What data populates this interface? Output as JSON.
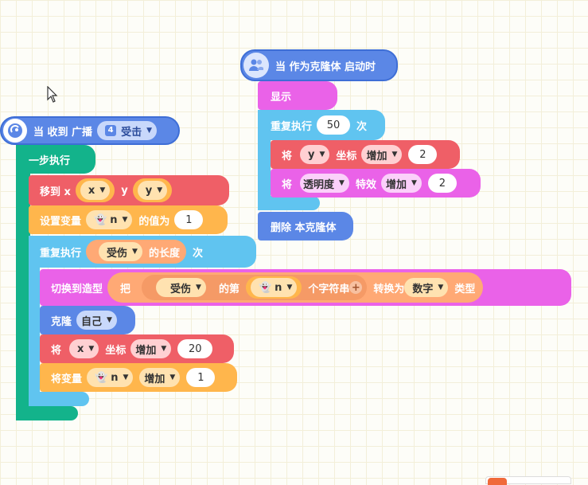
{
  "colors": {
    "event": "#5b87e6",
    "event_border": "#3e6ed6",
    "control_teal": "#13b38b",
    "control_blue": "#60c4f0",
    "motion": "#ef5f67",
    "variable": "#ffb64c",
    "looks": "#ea62e8",
    "operator": "#ffa975",
    "clone_hat": "#5b87e6"
  },
  "hat_broadcast": {
    "icon": "broadcast-icon",
    "label": "当 收到 广播",
    "badge": "4",
    "message": "受击"
  },
  "one_step": {
    "label": "一步执行"
  },
  "move_to": {
    "label": "移到 x",
    "x_value": "x",
    "y_label": "y",
    "y_value": "y"
  },
  "set_var": {
    "label": "设置变量",
    "var_name": "n",
    "mid": "的值为",
    "value": "1"
  },
  "repeat_main": {
    "label": "重复执行",
    "list_name": "受伤",
    "length_label": "的长度",
    "times_label": "次"
  },
  "switch_costume": {
    "label": "切换到造型",
    "ba": "把",
    "string_value": "受伤",
    "di": "的第",
    "var_name": "n",
    "char_label": "个字符串",
    "convert_label": "转换为",
    "type_value": "数字",
    "type_label": "类型"
  },
  "clone": {
    "label": "克隆",
    "target": "自己"
  },
  "change_x": {
    "jiang": "将",
    "axis": "x",
    "coord": "坐标",
    "op": "增加",
    "value": "20"
  },
  "change_var": {
    "label": "将变量",
    "var_name": "n",
    "op": "增加",
    "value": "1"
  },
  "hat_clone": {
    "icon": "clone-icon",
    "label": "当 作为克隆体 启动时"
  },
  "show": {
    "label": "显示"
  },
  "repeat_clone": {
    "label": "重复执行",
    "times": "50",
    "times_label": "次"
  },
  "change_y": {
    "jiang": "将",
    "axis": "y",
    "coord": "坐标",
    "op": "增加",
    "value": "2"
  },
  "change_effect": {
    "jiang": "将",
    "effect": "透明度",
    "effect_label": "特效",
    "op": "增加",
    "value": "2"
  },
  "delete_clone": {
    "label": "删除 本克隆体"
  }
}
